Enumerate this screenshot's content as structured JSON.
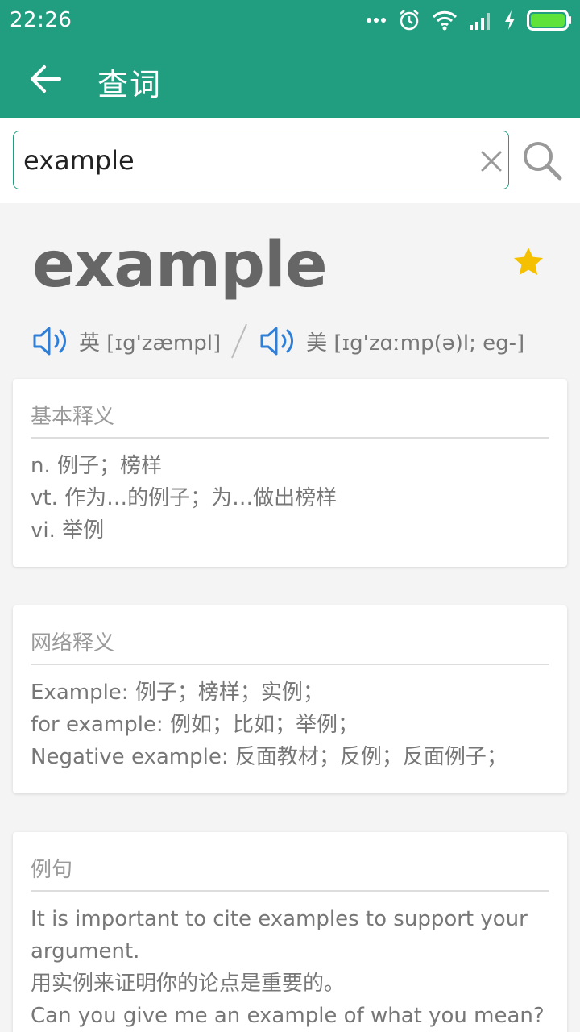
{
  "status_bar": {
    "time": "22:26"
  },
  "app_bar": {
    "title": "查词"
  },
  "search": {
    "value": "example"
  },
  "word": {
    "headword": "example",
    "uk_label": "英 [ɪg'zæmpl]",
    "us_label": "美 [ɪg'zɑːmp(ə)l; eg-]"
  },
  "basic": {
    "title": "基本释义",
    "lines": [
      "n. 例子；榜样",
      "vt. 作为…的例子；为…做出榜样",
      "vi. 举例"
    ]
  },
  "web": {
    "title": "网络释义",
    "lines": [
      "Example:  例子；榜样；实例；",
      "for example:  例如；比如；举例；",
      "Negative example:  反面教材；反例；反面例子；"
    ]
  },
  "examples": {
    "title": "例句",
    "lines": [
      "It is important to cite examples to support your argument.",
      "用实例来证明你的论点是重要的。",
      "Can you give me an example of what you mean?"
    ]
  },
  "colors": {
    "primary": "#219e80",
    "star": "#f5c000",
    "speaker": "#2f7fd8"
  }
}
